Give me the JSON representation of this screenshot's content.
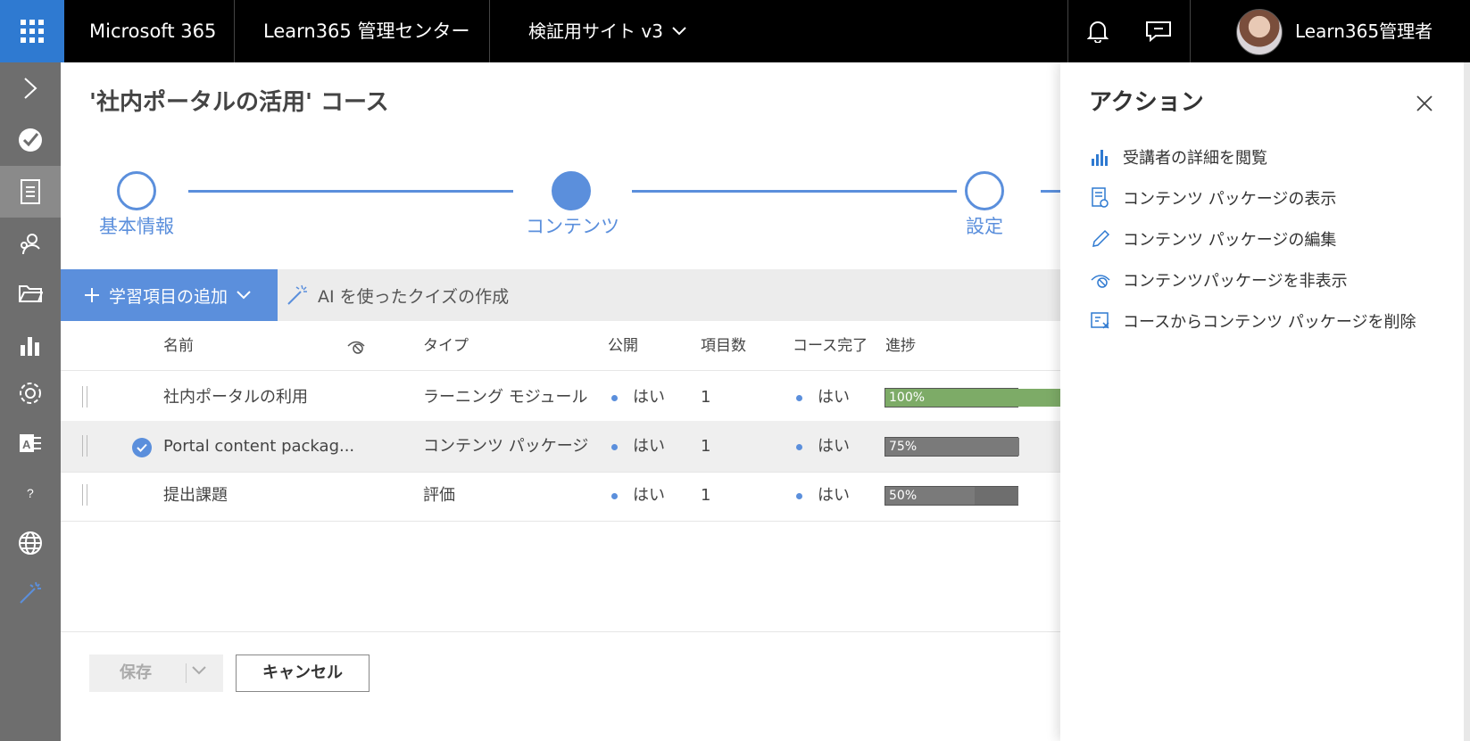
{
  "topbar": {
    "brand": "Microsoft 365",
    "admin_title": "Learn365 管理センター",
    "site_picker": "検証用サイト v3",
    "user_name": "Learn365管理者"
  },
  "page": {
    "title": "'社内ポータルの活用' コース"
  },
  "steps": [
    {
      "label": "基本情報",
      "state": "empty"
    },
    {
      "label": "コンテンツ",
      "state": "current"
    },
    {
      "label": "設定",
      "state": "empty"
    }
  ],
  "commands": {
    "add_label": "学習項目の追加",
    "ai_label": "AI を使ったクイズの作成"
  },
  "table": {
    "headers": {
      "name": "名前",
      "type": "タイプ",
      "published": "公開",
      "item_count": "項目数",
      "course_complete": "コース完了",
      "progress": "進捗"
    },
    "rows": [
      {
        "name": "社内ポータルの利用",
        "type": "ラーニング モジュール",
        "published": "はい",
        "count": "1",
        "complete": "はい",
        "progress_label": "100%",
        "progress": 1.0,
        "color": "#7dab67",
        "selected": false
      },
      {
        "name": "Portal content packag...",
        "type": "コンテンツ パッケージ",
        "published": "はい",
        "count": "1",
        "complete": "はい",
        "progress_label": "75%",
        "progress": 0.75,
        "color": "#7a7a7a",
        "selected": true
      },
      {
        "name": "提出課題",
        "type": "評価",
        "published": "はい",
        "count": "1",
        "complete": "はい",
        "progress_label": "50%",
        "progress": 0.5,
        "color": "#7a7a7a",
        "selected": false
      }
    ]
  },
  "footer": {
    "save_label": "保存",
    "cancel_label": "キャンセル"
  },
  "panel": {
    "title": "アクション",
    "actions": [
      {
        "label": "受講者の詳細を閲覧",
        "icon": "bar-chart-icon"
      },
      {
        "label": "コンテンツ パッケージの表示",
        "icon": "document-view-icon"
      },
      {
        "label": "コンテンツ パッケージの編集",
        "icon": "pencil-icon"
      },
      {
        "label": "コンテンツパッケージを非表示",
        "icon": "hide-icon"
      },
      {
        "label": "コースからコンテンツ パッケージを削除",
        "icon": "remove-package-icon"
      }
    ]
  },
  "colors": {
    "accent": "#5b8fdc",
    "waffle": "#2f7ad1",
    "rail": "#6e6e6e",
    "progress_green": "#7dab67"
  }
}
